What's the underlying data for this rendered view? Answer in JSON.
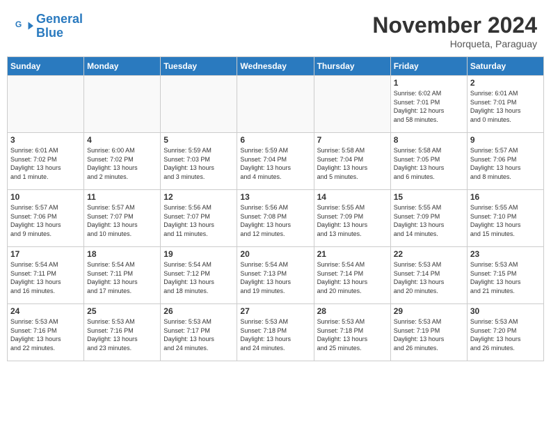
{
  "header": {
    "logo_line1": "General",
    "logo_line2": "Blue",
    "month": "November 2024",
    "location": "Horqueta, Paraguay"
  },
  "weekdays": [
    "Sunday",
    "Monday",
    "Tuesday",
    "Wednesday",
    "Thursday",
    "Friday",
    "Saturday"
  ],
  "weeks": [
    [
      {
        "day": "",
        "info": ""
      },
      {
        "day": "",
        "info": ""
      },
      {
        "day": "",
        "info": ""
      },
      {
        "day": "",
        "info": ""
      },
      {
        "day": "",
        "info": ""
      },
      {
        "day": "1",
        "info": "Sunrise: 6:02 AM\nSunset: 7:01 PM\nDaylight: 12 hours\nand 58 minutes."
      },
      {
        "day": "2",
        "info": "Sunrise: 6:01 AM\nSunset: 7:01 PM\nDaylight: 13 hours\nand 0 minutes."
      }
    ],
    [
      {
        "day": "3",
        "info": "Sunrise: 6:01 AM\nSunset: 7:02 PM\nDaylight: 13 hours\nand 1 minute."
      },
      {
        "day": "4",
        "info": "Sunrise: 6:00 AM\nSunset: 7:02 PM\nDaylight: 13 hours\nand 2 minutes."
      },
      {
        "day": "5",
        "info": "Sunrise: 5:59 AM\nSunset: 7:03 PM\nDaylight: 13 hours\nand 3 minutes."
      },
      {
        "day": "6",
        "info": "Sunrise: 5:59 AM\nSunset: 7:04 PM\nDaylight: 13 hours\nand 4 minutes."
      },
      {
        "day": "7",
        "info": "Sunrise: 5:58 AM\nSunset: 7:04 PM\nDaylight: 13 hours\nand 5 minutes."
      },
      {
        "day": "8",
        "info": "Sunrise: 5:58 AM\nSunset: 7:05 PM\nDaylight: 13 hours\nand 6 minutes."
      },
      {
        "day": "9",
        "info": "Sunrise: 5:57 AM\nSunset: 7:06 PM\nDaylight: 13 hours\nand 8 minutes."
      }
    ],
    [
      {
        "day": "10",
        "info": "Sunrise: 5:57 AM\nSunset: 7:06 PM\nDaylight: 13 hours\nand 9 minutes."
      },
      {
        "day": "11",
        "info": "Sunrise: 5:57 AM\nSunset: 7:07 PM\nDaylight: 13 hours\nand 10 minutes."
      },
      {
        "day": "12",
        "info": "Sunrise: 5:56 AM\nSunset: 7:07 PM\nDaylight: 13 hours\nand 11 minutes."
      },
      {
        "day": "13",
        "info": "Sunrise: 5:56 AM\nSunset: 7:08 PM\nDaylight: 13 hours\nand 12 minutes."
      },
      {
        "day": "14",
        "info": "Sunrise: 5:55 AM\nSunset: 7:09 PM\nDaylight: 13 hours\nand 13 minutes."
      },
      {
        "day": "15",
        "info": "Sunrise: 5:55 AM\nSunset: 7:09 PM\nDaylight: 13 hours\nand 14 minutes."
      },
      {
        "day": "16",
        "info": "Sunrise: 5:55 AM\nSunset: 7:10 PM\nDaylight: 13 hours\nand 15 minutes."
      }
    ],
    [
      {
        "day": "17",
        "info": "Sunrise: 5:54 AM\nSunset: 7:11 PM\nDaylight: 13 hours\nand 16 minutes."
      },
      {
        "day": "18",
        "info": "Sunrise: 5:54 AM\nSunset: 7:11 PM\nDaylight: 13 hours\nand 17 minutes."
      },
      {
        "day": "19",
        "info": "Sunrise: 5:54 AM\nSunset: 7:12 PM\nDaylight: 13 hours\nand 18 minutes."
      },
      {
        "day": "20",
        "info": "Sunrise: 5:54 AM\nSunset: 7:13 PM\nDaylight: 13 hours\nand 19 minutes."
      },
      {
        "day": "21",
        "info": "Sunrise: 5:54 AM\nSunset: 7:14 PM\nDaylight: 13 hours\nand 20 minutes."
      },
      {
        "day": "22",
        "info": "Sunrise: 5:53 AM\nSunset: 7:14 PM\nDaylight: 13 hours\nand 20 minutes."
      },
      {
        "day": "23",
        "info": "Sunrise: 5:53 AM\nSunset: 7:15 PM\nDaylight: 13 hours\nand 21 minutes."
      }
    ],
    [
      {
        "day": "24",
        "info": "Sunrise: 5:53 AM\nSunset: 7:16 PM\nDaylight: 13 hours\nand 22 minutes."
      },
      {
        "day": "25",
        "info": "Sunrise: 5:53 AM\nSunset: 7:16 PM\nDaylight: 13 hours\nand 23 minutes."
      },
      {
        "day": "26",
        "info": "Sunrise: 5:53 AM\nSunset: 7:17 PM\nDaylight: 13 hours\nand 24 minutes."
      },
      {
        "day": "27",
        "info": "Sunrise: 5:53 AM\nSunset: 7:18 PM\nDaylight: 13 hours\nand 24 minutes."
      },
      {
        "day": "28",
        "info": "Sunrise: 5:53 AM\nSunset: 7:18 PM\nDaylight: 13 hours\nand 25 minutes."
      },
      {
        "day": "29",
        "info": "Sunrise: 5:53 AM\nSunset: 7:19 PM\nDaylight: 13 hours\nand 26 minutes."
      },
      {
        "day": "30",
        "info": "Sunrise: 5:53 AM\nSunset: 7:20 PM\nDaylight: 13 hours\nand 26 minutes."
      }
    ]
  ]
}
